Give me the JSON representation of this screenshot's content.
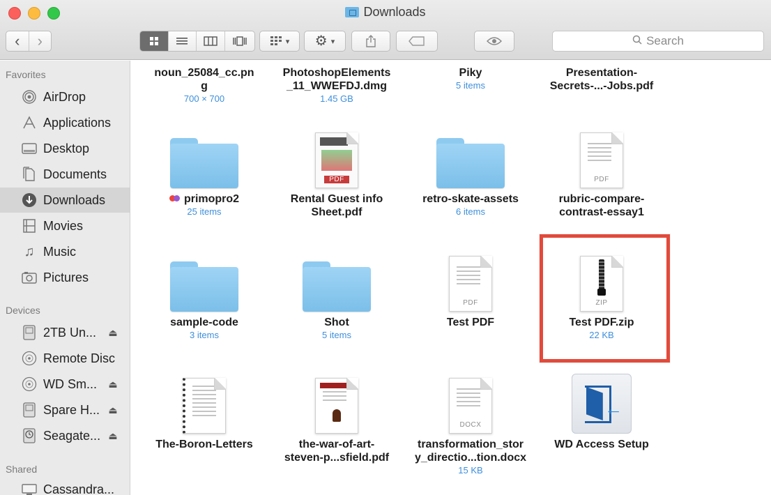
{
  "window": {
    "title": "Downloads"
  },
  "toolbar": {
    "back_glyph": "‹",
    "forward_glyph": "›",
    "search_placeholder": "Search",
    "view_icons": [
      "icon-view-icon",
      "list-view-icon",
      "column-view-icon",
      "cover-flow-icon"
    ],
    "arrange_icon": "arrange-icon",
    "action_icon": "gear-icon",
    "share_icon": "share-icon",
    "tags_icon": "tag-icon",
    "preview_icon": "eye-icon"
  },
  "sidebar": {
    "favorites_header": "Favorites",
    "favorites": [
      {
        "label": "AirDrop",
        "icon": "airdrop-icon"
      },
      {
        "label": "Applications",
        "icon": "applications-icon"
      },
      {
        "label": "Desktop",
        "icon": "desktop-icon"
      },
      {
        "label": "Documents",
        "icon": "documents-icon"
      },
      {
        "label": "Downloads",
        "icon": "downloads-icon",
        "selected": true
      },
      {
        "label": "Movies",
        "icon": "movies-icon"
      },
      {
        "label": "Music",
        "icon": "music-icon"
      },
      {
        "label": "Pictures",
        "icon": "pictures-icon"
      }
    ],
    "devices_header": "Devices",
    "devices": [
      {
        "label": "2TB Un...",
        "icon": "drive-icon",
        "eject": "⏏"
      },
      {
        "label": "Remote Disc",
        "icon": "disc-icon"
      },
      {
        "label": "WD Sm...",
        "icon": "disc-icon",
        "eject": "⏏"
      },
      {
        "label": "Spare H...",
        "icon": "drive-icon",
        "eject": "⏏"
      },
      {
        "label": "Seagate...",
        "icon": "timemachine-drive-icon",
        "eject": "⏏"
      }
    ],
    "shared_header": "Shared",
    "shared": [
      {
        "label": "Cassandra...",
        "icon": "computer-icon"
      }
    ]
  },
  "files": [
    {
      "name": "noun_25084_cc.pn\ng",
      "meta": "700 × 700",
      "kind": "image"
    },
    {
      "name": "PhotoshopElements\n_11_WWEFDJ.dmg",
      "meta": "1.45 GB",
      "kind": "dmg"
    },
    {
      "name": "Piky",
      "meta": "5 items",
      "kind": "folder"
    },
    {
      "name": "Presentation-\nSecrets-...-Jobs.pdf",
      "meta": "",
      "kind": "pdf"
    },
    {
      "name": "primopro2",
      "meta": "25 items",
      "kind": "folder",
      "tag": true,
      "tag_colors": [
        "#f0443a",
        "#9b59d0"
      ]
    },
    {
      "name": "Rental  Guest info\nSheet.pdf",
      "meta": "",
      "kind": "pdf-rich",
      "badge": "PDF"
    },
    {
      "name": "retro-skate-assets",
      "meta": "6 items",
      "kind": "folder"
    },
    {
      "name": "rubric-compare-\ncontrast-essay1",
      "meta": "",
      "kind": "pdf",
      "badge": "PDF"
    },
    {
      "name": "sample-code",
      "meta": "3 items",
      "kind": "folder"
    },
    {
      "name": "Shot",
      "meta": "5 items",
      "kind": "folder"
    },
    {
      "name": "Test PDF",
      "meta": "",
      "kind": "pdf",
      "badge": "PDF"
    },
    {
      "name": "Test PDF.zip",
      "meta": "22 KB",
      "kind": "zip",
      "badge": "ZIP",
      "highlighted": true
    },
    {
      "name": "The-Boron-Letters",
      "meta": "",
      "kind": "spiral"
    },
    {
      "name": "the-war-of-art-\nsteven-p...sfield.pdf",
      "meta": "",
      "kind": "book"
    },
    {
      "name": "transformation_stor\ny_directio...tion.docx",
      "meta": "15 KB",
      "kind": "docx",
      "badge": "DOCX"
    },
    {
      "name": "WD Access Setup",
      "meta": "",
      "kind": "app"
    }
  ],
  "colors": {
    "highlight": "#e24a3b",
    "meta_text": "#3e8fdc",
    "folder": "#8ecaf0",
    "sidebar_bg": "#eaeaea",
    "selected_row": "#d5d5d5"
  }
}
